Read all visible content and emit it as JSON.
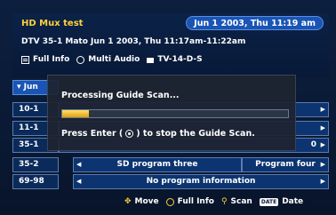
{
  "header": {
    "title": "HD Mux test",
    "datetime": "Jun 1 2003, Thu 11:19 am",
    "description": "DTV 35-1 Mato Jun 1 2003, Thu  11:17am-11:22am",
    "full_info": "Full Info",
    "multi_audio": "Multi Audio",
    "rating": "TV-14-D-S"
  },
  "grid": {
    "month_label": "Jun",
    "channels": [
      "10-1",
      "11-1",
      "35-1",
      "35-2",
      "69-98"
    ],
    "row_35_1_tail": "0",
    "row_35_2_programs": [
      "SD program three",
      "Program four"
    ],
    "row_69_98_program": "No program information"
  },
  "dialog": {
    "title": "Processing Guide Scan...",
    "progress_percent": 12,
    "message_prefix": "Press Enter (",
    "message_suffix": ") to stop the Guide Scan."
  },
  "footer": {
    "move": "Move",
    "full_info": "Full Info",
    "scan": "Scan",
    "date_badge": "DATE",
    "date": "Date"
  },
  "colors": {
    "accent_yellow": "#ffd23c",
    "pill_blue": "#1a55b5",
    "background_navy": "#0a1a35"
  }
}
